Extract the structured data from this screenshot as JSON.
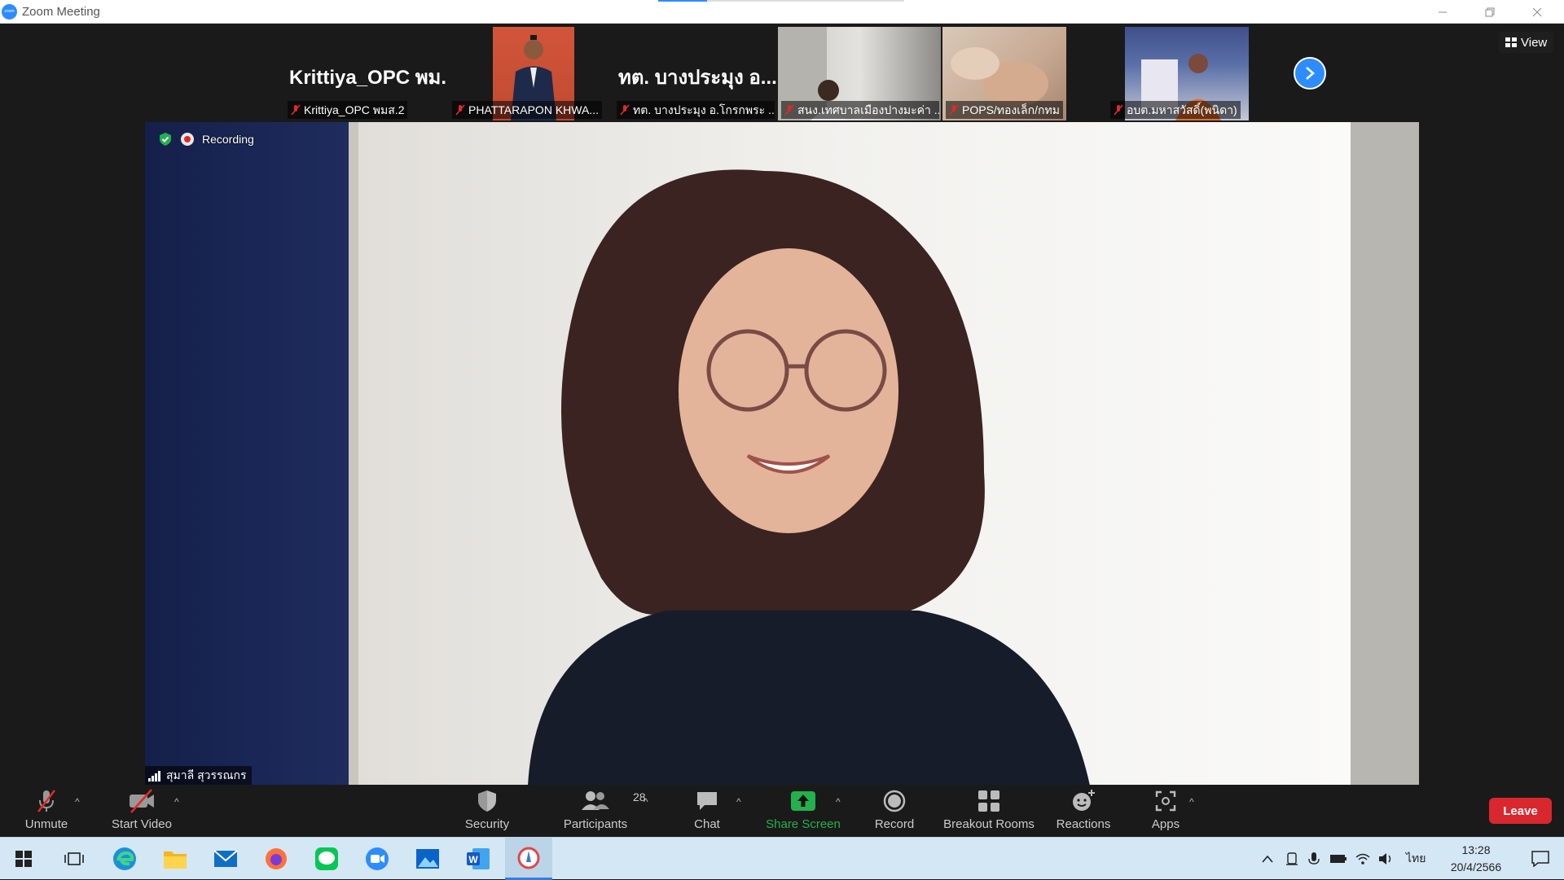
{
  "window": {
    "title": "Zoom Meeting",
    "logo_text": "zoom"
  },
  "gallery": {
    "tiles": [
      {
        "big_name": "Krittiya_OPC พม...",
        "label": "Krittiya_OPC พมส.2",
        "video": false
      },
      {
        "big_name": "",
        "label": "PHATTARAPON KHWA...",
        "video": true
      },
      {
        "big_name": "ทต. บางประมุง อ....",
        "label": "ทต. บางประมุง อ.โกรกพระ ...",
        "video": false
      },
      {
        "big_name": "",
        "label": "สนง.เทศบาลเมืองปางมะค่า ...",
        "video": true
      },
      {
        "big_name": "",
        "label": "POPS/ทองเล็ก/กทม",
        "video": true
      },
      {
        "big_name": "",
        "label": "อบต.มหาสวัสดิ์(พนิดา)",
        "video": true
      }
    ],
    "next_icon": "chevron-right-icon",
    "view_label": "View"
  },
  "main_video": {
    "recording_label": "Recording",
    "speaker_name": "สุมาลี สุวรรณกร"
  },
  "toolbar": {
    "unmute": "Unmute",
    "start_video": "Start Video",
    "security": "Security",
    "participants": "Participants",
    "participants_count": "28",
    "chat": "Chat",
    "share_screen": "Share Screen",
    "record": "Record",
    "breakout_rooms": "Breakout Rooms",
    "reactions": "Reactions",
    "apps": "Apps",
    "leave": "Leave"
  },
  "colors": {
    "accent": "#2d8cff",
    "leave": "#d9272e",
    "share": "#23b14d",
    "muted": "#e02828"
  },
  "taskbar": {
    "apps": [
      "windows-start-icon",
      "task-view-icon",
      "edge-icon",
      "file-explorer-icon",
      "mail-icon",
      "firefox-icon",
      "line-icon",
      "zoom-icon",
      "photos-icon",
      "word-icon",
      "paint-icon"
    ],
    "language": "ไทย",
    "time": "13:28",
    "date": "20/4/2566"
  }
}
